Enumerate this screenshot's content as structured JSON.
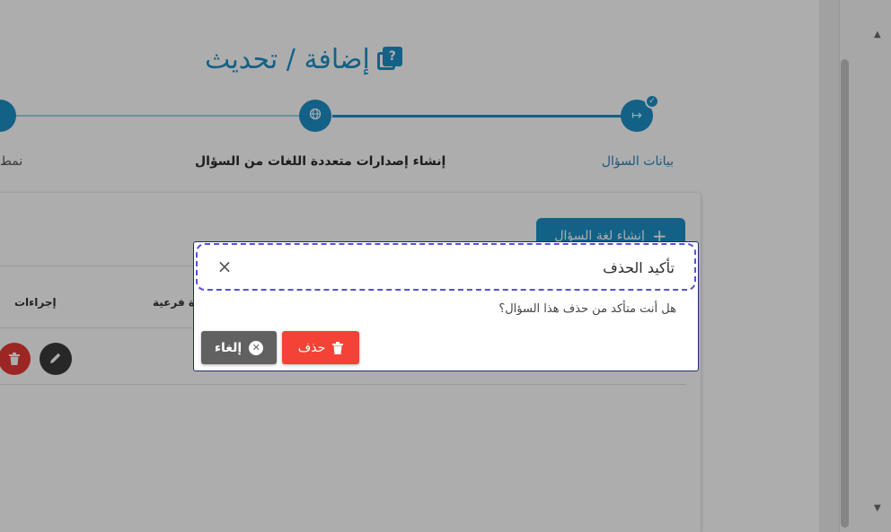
{
  "page": {
    "title": "إضافة / تحديث",
    "title_icon": "question-copy-icon"
  },
  "stepper": {
    "steps": [
      {
        "label": "بيانات السؤال",
        "icon": "arrow-right-to-bracket-icon",
        "state": "done"
      },
      {
        "label": "إنشاء إصدارات متعددة اللغات من السؤال",
        "icon": "globe-icon",
        "state": "active"
      },
      {
        "label": "نمط",
        "icon": "",
        "state": "upcoming"
      }
    ]
  },
  "card": {
    "create_button_label": "إنشاء لغة السؤال",
    "columns": [
      {
        "label": "إجراءات"
      },
      {
        "label": "ة فرعية"
      }
    ]
  },
  "modal": {
    "title": "تأكيد الحذف",
    "message": "هل أنت متأكد من حذف هذا السؤال؟",
    "delete_label": "حذف",
    "cancel_label": "إلغاء"
  },
  "colors": {
    "primary": "#1d8fc8",
    "danger": "#f44336",
    "neutral": "#616161",
    "focus_outline": "#5b4fd6"
  }
}
